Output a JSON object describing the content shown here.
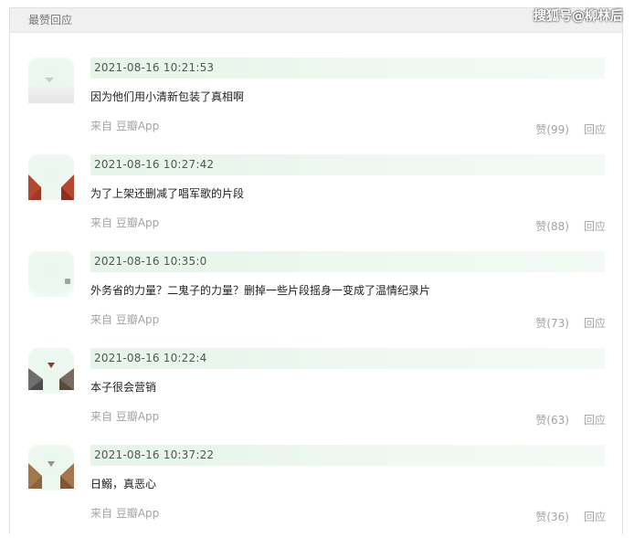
{
  "header": {
    "title": "最赞回应"
  },
  "watermark": "搜狐号@柳林后",
  "comments": [
    {
      "date": "2021-08-16 10:21:53",
      "text": "因为他们用小清新包装了真相啊",
      "from": "来自 豆瓣App",
      "likes": "赞(99)",
      "reply": "回应"
    },
    {
      "date": "2021-08-16 10:27:42",
      "text": "为了上架还删减了唱军歌的片段",
      "from": "来自 豆瓣App",
      "likes": "赞(88)",
      "reply": "回应"
    },
    {
      "date": "2021-08-16 10:35:0",
      "text": "外务省的力量？二鬼子的力量？删掉一些片段摇身一变成了温情纪录片",
      "from": "来自 豆瓣App",
      "likes": "赞(73)",
      "reply": "回应"
    },
    {
      "date": "2021-08-16 10:22:4",
      "text": "本子很会营销",
      "from": "来自 豆瓣App",
      "likes": "赞(63)",
      "reply": "回应"
    },
    {
      "date": "2021-08-16 10:37:22",
      "text": "日鰯，真恶心",
      "from": "来自 豆瓣App",
      "likes": "赞(36)",
      "reply": "回应"
    }
  ]
}
